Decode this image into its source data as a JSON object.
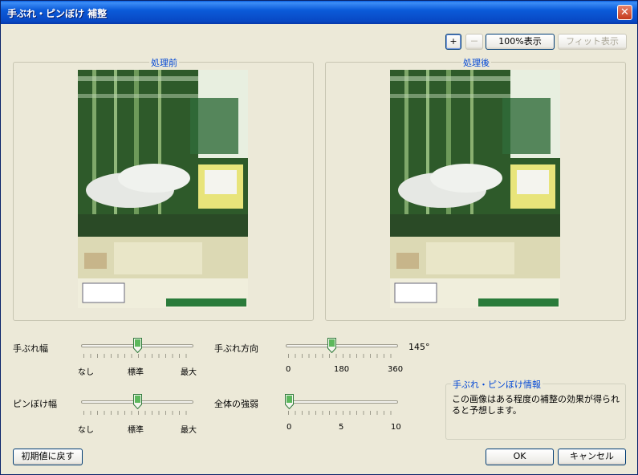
{
  "window": {
    "title": "手ぶれ・ピンぼけ 補整"
  },
  "toolbar": {
    "zoom_in": "+",
    "zoom_out": "－",
    "actual_size": "100%表示",
    "fit": "フィット表示"
  },
  "panels": {
    "before": "処理前",
    "after": "処理後"
  },
  "sliders": {
    "shake_amount": {
      "label": "手ぶれ幅",
      "min": "なし",
      "mid": "標準",
      "max": "最大",
      "value_fraction": 0.5
    },
    "shake_direction": {
      "label": "手ぶれ方向",
      "min": "0",
      "mid": "180",
      "max": "360",
      "value": "145°",
      "value_fraction": 0.4
    },
    "blur_amount": {
      "label": "ピンぼけ幅",
      "min": "なし",
      "mid": "標準",
      "max": "最大",
      "value_fraction": 0.5
    },
    "overall_strength": {
      "label": "全体の強弱",
      "min": "0",
      "mid": "5",
      "max": "10",
      "value_fraction": 0.0
    }
  },
  "info": {
    "title": "手ぶれ・ピンぼけ情報",
    "text": "この画像はある程度の補整の効果が得られると予想します。"
  },
  "footer": {
    "reset": "初期値に戻す",
    "ok": "OK",
    "cancel": "キャンセル"
  },
  "colors": {
    "title_bar": "#0b5bd9",
    "accent_text": "#0046d5",
    "window_bg": "#ece9d8"
  }
}
